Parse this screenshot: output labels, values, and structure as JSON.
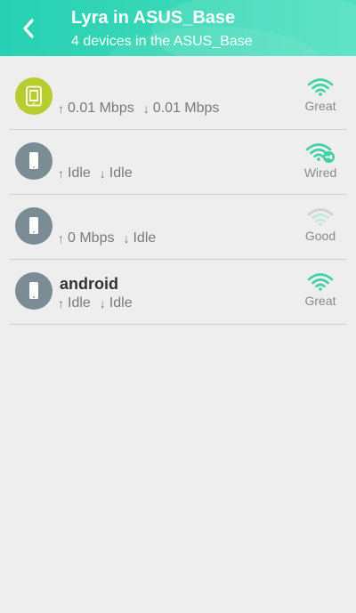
{
  "header": {
    "title": "Lyra in ASUS_Base",
    "subtitle": "4 devices in the ASUS_Base",
    "back_icon": "chevron-left-icon"
  },
  "colors": {
    "accent": "#2fd4b5",
    "tablet_avatar": "#b7cc2e",
    "phone_avatar": "#7c8c95",
    "wifi_good": "#3fd0a4",
    "wifi_faint": "#c9d3d0",
    "text_muted": "#7a7a7a"
  },
  "devices": [
    {
      "name": "",
      "icon": "tablet-icon",
      "up": "0.01 Mbps",
      "down": "0.01 Mbps",
      "signal": "Great",
      "signal_icon": "wifi-icon"
    },
    {
      "name": "",
      "icon": "phone-icon",
      "up": "Idle",
      "down": "Idle",
      "signal": "Wired",
      "signal_icon": "wifi-wired-icon"
    },
    {
      "name": "",
      "icon": "phone-icon",
      "up": "0 Mbps",
      "down": "Idle",
      "signal": "Good",
      "signal_icon": "wifi-icon"
    },
    {
      "name": "android",
      "icon": "phone-icon",
      "up": "Idle",
      "down": "Idle",
      "signal": "Great",
      "signal_icon": "wifi-icon"
    }
  ]
}
